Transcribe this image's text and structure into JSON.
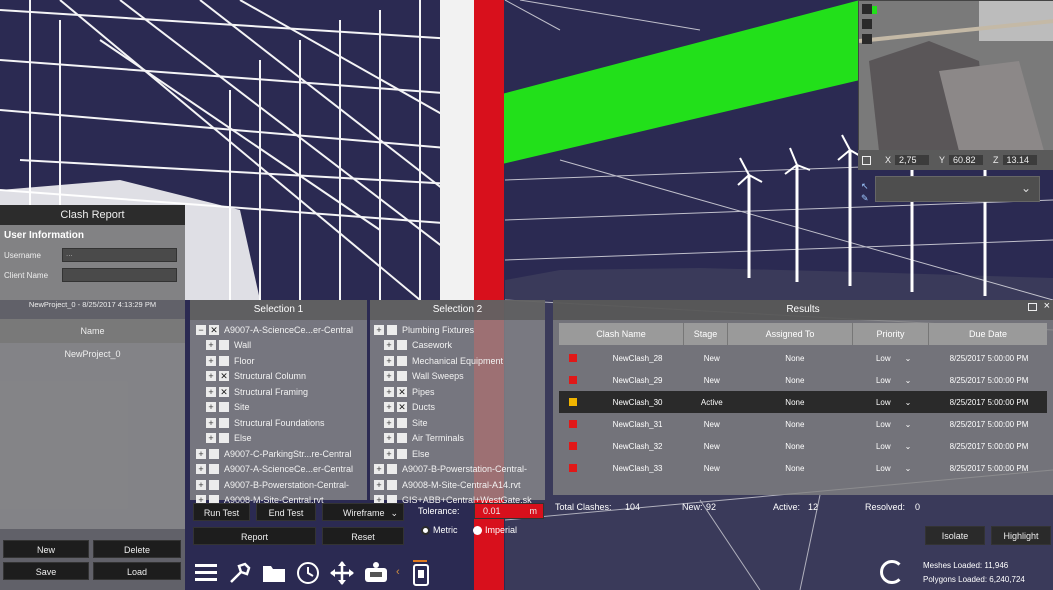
{
  "clash_report": {
    "title": "Clash Report",
    "user_info_label": "User Information",
    "username_label": "Username",
    "username_value": "...",
    "client_name_label": "Client Name",
    "client_name_value": "",
    "project_stamp": "NewProject_0 - 8/25/2017 4:13:29 PM",
    "name_header": "Name",
    "project_name": "NewProject_0",
    "buttons": {
      "new": "New",
      "delete": "Delete",
      "save": "Save",
      "load": "Load"
    }
  },
  "selection1": {
    "title": "Selection 1",
    "items": [
      {
        "pm": "−",
        "checked": true,
        "label": "A9007-A-ScienceCe...er-Central"
      },
      {
        "pm": "+",
        "checked": false,
        "label": "Wall"
      },
      {
        "pm": "+",
        "checked": false,
        "label": "Floor"
      },
      {
        "pm": "+",
        "checked": true,
        "label": "Structural Column"
      },
      {
        "pm": "+",
        "checked": true,
        "label": "Structural Framing"
      },
      {
        "pm": "+",
        "checked": false,
        "label": "Site"
      },
      {
        "pm": "+",
        "checked": false,
        "label": "Structural Foundations"
      },
      {
        "pm": "+",
        "checked": false,
        "label": "Else"
      },
      {
        "pm": "+",
        "checked": false,
        "label": "A9007-C-ParkingStr...re-Central"
      },
      {
        "pm": "+",
        "checked": false,
        "label": "A9007-A-ScienceCe...er-Central"
      },
      {
        "pm": "+",
        "checked": false,
        "label": "A9007-B-Powerstation-Central-"
      },
      {
        "pm": "+",
        "checked": false,
        "label": "A9008-M-Site-Central.rvt"
      }
    ]
  },
  "selection2": {
    "title": "Selection 2",
    "items": [
      {
        "pm": "+",
        "checked": false,
        "label": "Plumbing Fixtures"
      },
      {
        "pm": "+",
        "checked": false,
        "label": "Casework"
      },
      {
        "pm": "+",
        "checked": false,
        "label": "Mechanical Equipment"
      },
      {
        "pm": "+",
        "checked": false,
        "label": "Wall Sweeps"
      },
      {
        "pm": "+",
        "checked": true,
        "label": "Pipes"
      },
      {
        "pm": "+",
        "checked": true,
        "label": "Ducts"
      },
      {
        "pm": "+",
        "checked": false,
        "label": "Site"
      },
      {
        "pm": "+",
        "checked": false,
        "label": "Air Terminals"
      },
      {
        "pm": "+",
        "checked": false,
        "label": "Else"
      },
      {
        "pm": "+",
        "checked": false,
        "label": "A9007-B-Powerstation-Central-"
      },
      {
        "pm": "+",
        "checked": false,
        "label": "A9008-M-Site-Central-A14.rvt"
      },
      {
        "pm": "+",
        "checked": false,
        "label": "GIS+ABB+Central+WestGate.sk"
      }
    ]
  },
  "results": {
    "title": "Results",
    "columns": [
      "Clash Name",
      "Stage",
      "Assigned To",
      "Priority",
      "Due Date"
    ],
    "rows": [
      {
        "color": "#e01818",
        "name": "NewClash_28",
        "stage": "New",
        "assigned": "None",
        "priority": "Low",
        "due": "8/25/2017 5:00:00 PM",
        "selected": false
      },
      {
        "color": "#e01818",
        "name": "NewClash_29",
        "stage": "New",
        "assigned": "None",
        "priority": "Low",
        "due": "8/25/2017 5:00:00 PM",
        "selected": false
      },
      {
        "color": "#f0b400",
        "name": "NewClash_30",
        "stage": "Active",
        "assigned": "None",
        "priority": "Low",
        "due": "8/25/2017 5:00:00 PM",
        "selected": true
      },
      {
        "color": "#e01818",
        "name": "NewClash_31",
        "stage": "New",
        "assigned": "None",
        "priority": "Low",
        "due": "8/25/2017 5:00:00 PM",
        "selected": false
      },
      {
        "color": "#e01818",
        "name": "NewClash_32",
        "stage": "New",
        "assigned": "None",
        "priority": "Low",
        "due": "8/25/2017 5:00:00 PM",
        "selected": false
      },
      {
        "color": "#e01818",
        "name": "NewClash_33",
        "stage": "New",
        "assigned": "None",
        "priority": "Low",
        "due": "8/25/2017 5:00:00 PM",
        "selected": false
      }
    ]
  },
  "controls": {
    "run_test": "Run Test",
    "end_test": "End Test",
    "report": "Report",
    "reset": "Reset",
    "view_mode": "Wireframe",
    "tolerance_label": "Tolerance:",
    "tolerance_value": "0.01",
    "tolerance_unit": "m",
    "metric": "Metric",
    "imperial": "Imperial"
  },
  "stats": {
    "total_label": "Total Clashes:",
    "total_value": "104",
    "new_label": "New:",
    "new_value": "92",
    "active_label": "Active:",
    "active_value": "12",
    "resolved_label": "Resolved:",
    "resolved_value": "0"
  },
  "actions": {
    "isolate": "Isolate",
    "highlight": "Highlight"
  },
  "minimap": {
    "x_label": "X",
    "x_value": "2,75",
    "y_label": "Y",
    "y_value": "60.82",
    "z_label": "Z",
    "z_value": "13.14"
  },
  "loaded": {
    "meshes": "Meshes Loaded: 11,946",
    "polygons": "Polygons Loaded: 6,240,724"
  },
  "toolbar_icons": [
    "menu-icon",
    "tools-icon",
    "folder-icon",
    "clock-icon",
    "move-icon",
    "vr-icon",
    "phone-icon"
  ],
  "colors": {
    "sky": "#2b2a52",
    "clash_red": "#d8101c",
    "clash_green": "#22e01a",
    "panel": "#8c8c8c",
    "dark_button": "#1d1d1d"
  }
}
